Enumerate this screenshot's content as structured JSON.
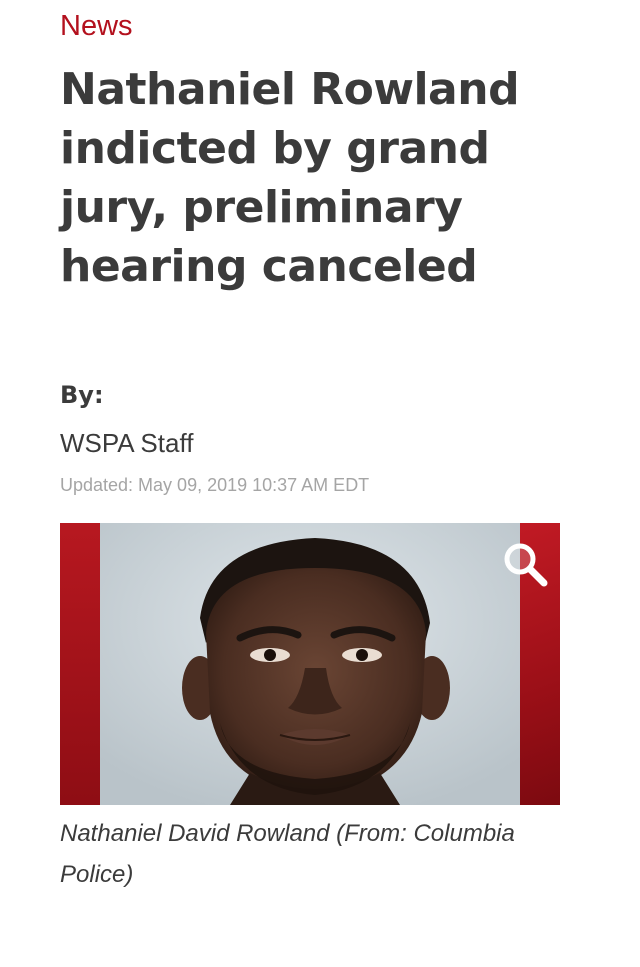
{
  "section": {
    "label": "News"
  },
  "article": {
    "headline": "Nathaniel Rowland indicted by grand jury, preliminary hearing canceled",
    "byline_label": "By:",
    "author": "WSPA Staff",
    "updated": "Updated: May 09, 2019 10:37 AM EDT"
  },
  "media": {
    "zoom_icon": "magnifier-icon",
    "caption": "Nathaniel David Rowland (From: Columbia Police)"
  },
  "colors": {
    "accent": "#b3101d",
    "text": "#3b3b3b",
    "muted": "#a5a5a5"
  }
}
